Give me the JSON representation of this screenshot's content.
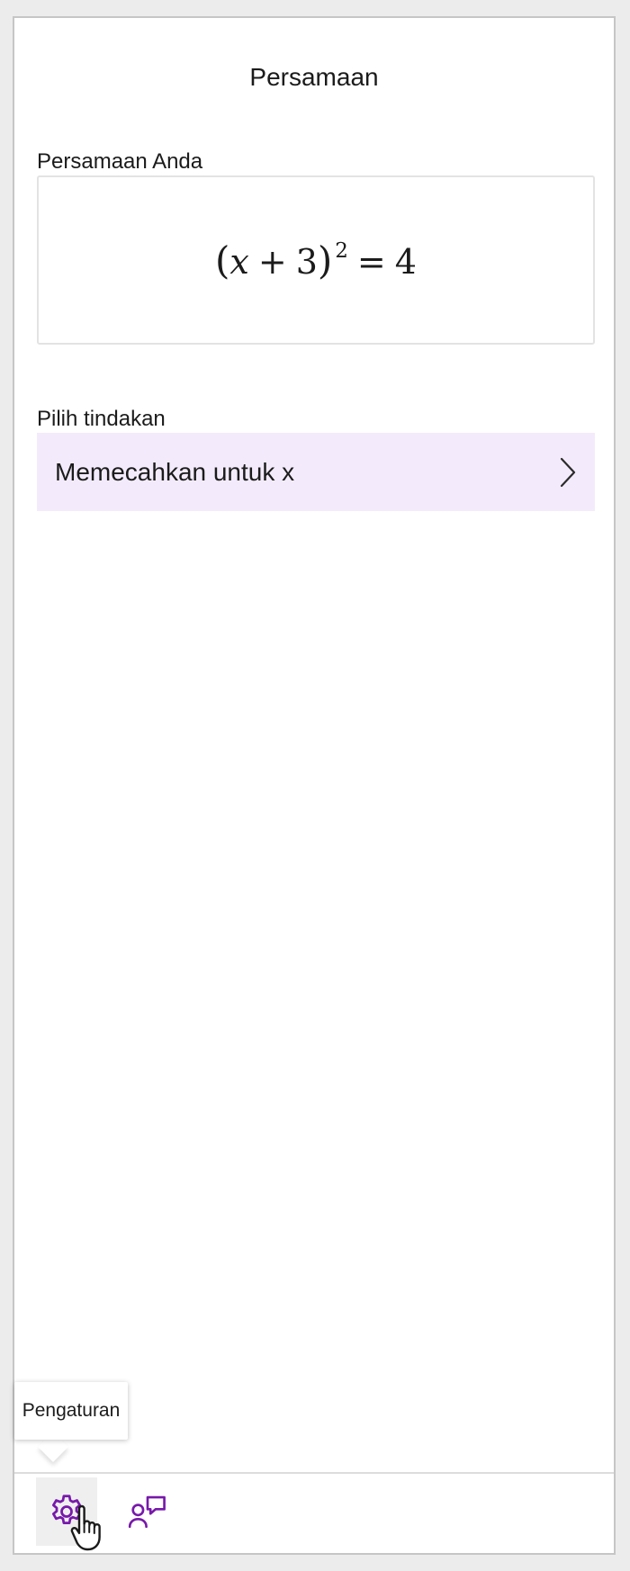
{
  "pane": {
    "title": "Persamaan"
  },
  "equation_section": {
    "label": "Persamaan Anda",
    "equation": {
      "open_paren": "(",
      "variable": "x",
      "plus": "+",
      "constant": "3",
      "close_paren": ")",
      "exponent": "2",
      "equals": "=",
      "rhs": "4"
    }
  },
  "action_section": {
    "label": "Pilih tindakan",
    "actions": [
      {
        "label": "Memecahkan untuk x"
      }
    ]
  },
  "toolbar": {
    "settings_tooltip": "Pengaturan"
  },
  "colors": {
    "accent_purple": "#7719aa",
    "action_row_bg": "#f3ebfb"
  }
}
